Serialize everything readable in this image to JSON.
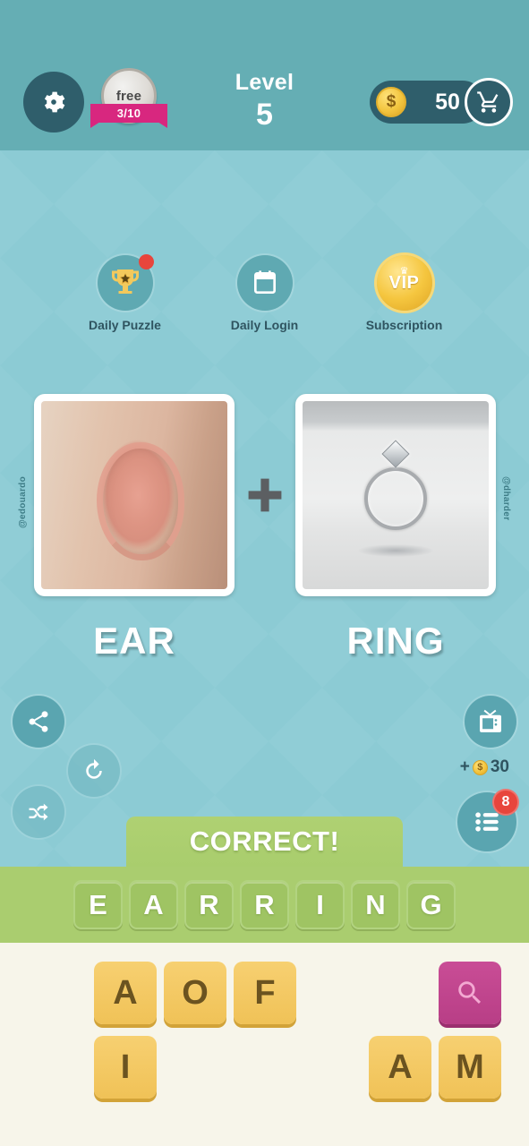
{
  "header": {
    "settings_icon": "gear-icon",
    "free_coin": {
      "label": "free",
      "progress": "3/10"
    },
    "level_word": "Level",
    "level_number": "5",
    "coin_symbol": "$",
    "coin_value": "50",
    "cart_icon": "shopping-cart-icon"
  },
  "promos": [
    {
      "label": "Daily Puzzle",
      "icon": "trophy-icon",
      "badge": true
    },
    {
      "label": "Daily Login",
      "icon": "calendar-icon",
      "badge": false
    },
    {
      "label": "Subscription",
      "icon": "vip-coin-icon",
      "badge": false,
      "vip_text": "VIP"
    }
  ],
  "puzzle": {
    "left": {
      "word": "EAR",
      "credit": "@edouardo",
      "image": "ear-photo"
    },
    "right": {
      "word": "RING",
      "credit": "@dharder",
      "image": "ring-photo"
    },
    "operator": "plus-icon"
  },
  "actions": {
    "share": "share-icon",
    "refresh": "refresh-icon",
    "shuffle": "shuffle-icon",
    "video": "tv-icon",
    "video_reward_prefix": "+",
    "video_reward_amount": "30",
    "video_reward_coin": "$",
    "levels": "list-icon",
    "levels_badge": "8"
  },
  "status": {
    "message": "CORRECT!"
  },
  "answer": {
    "letters": [
      "E",
      "A",
      "R",
      "R",
      "I",
      "N",
      "G"
    ]
  },
  "keyboard": {
    "row1": [
      "A",
      "O",
      "F"
    ],
    "row2": [
      "I"
    ],
    "row2_right": [
      "A",
      "M"
    ],
    "hint_icon": "search-icon"
  },
  "colors": {
    "header_teal": "#65aeb4",
    "body_teal": "#8ccbd4",
    "dark_teal": "#2f5e6b",
    "answer_green": "#aacd6f",
    "key_gold": "#f0c257",
    "hint_pink": "#b83e86",
    "badge_red": "#e8453c",
    "ribbon_pink": "#d8277f"
  }
}
